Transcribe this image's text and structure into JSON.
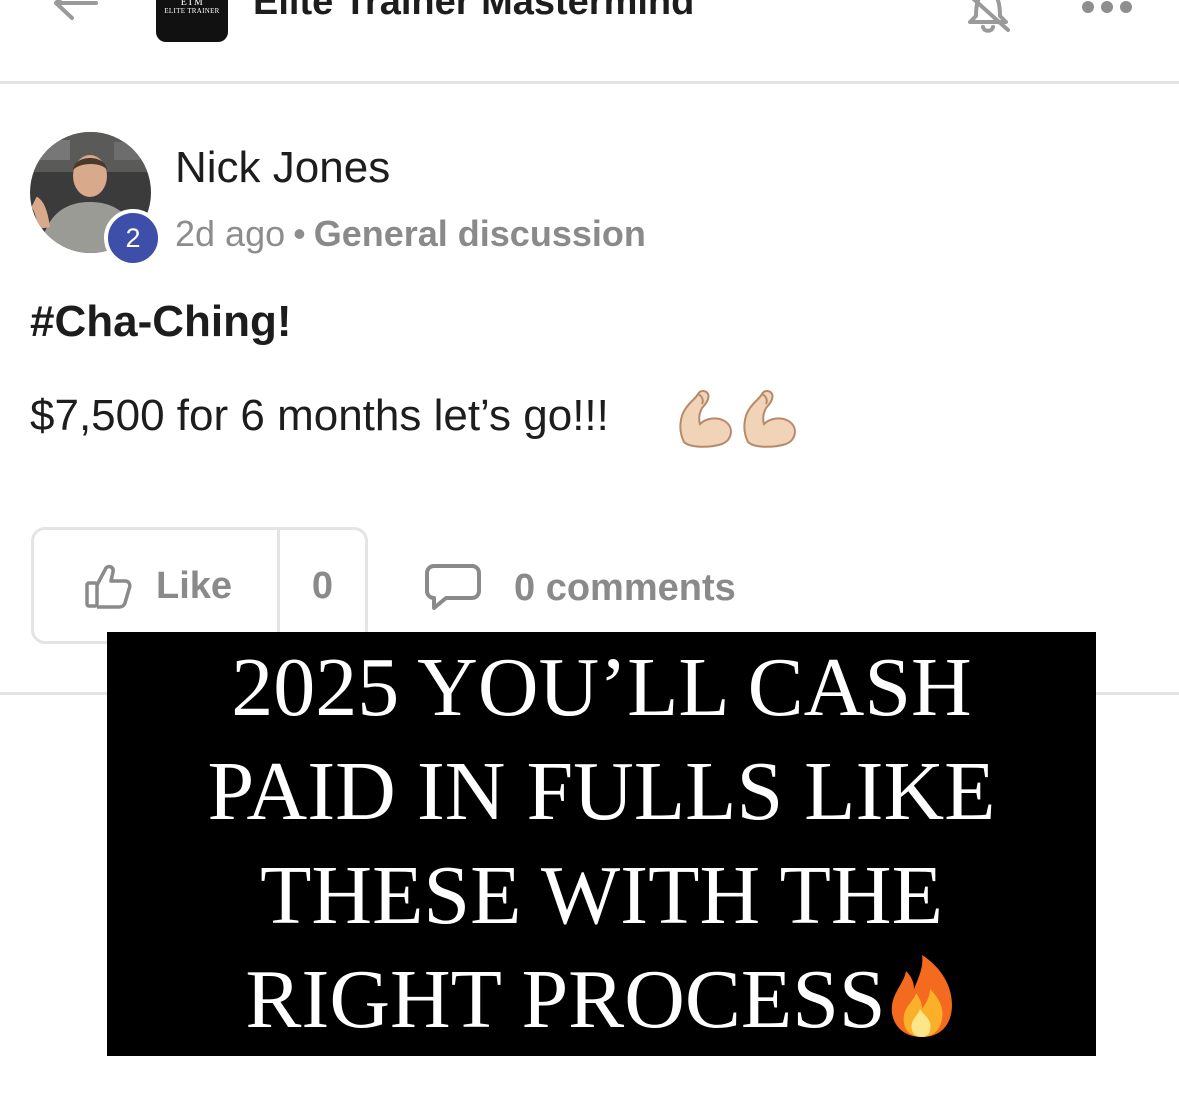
{
  "header": {
    "group_title": "Elite Trainer Mastermind",
    "logo_mark": "ETM",
    "logo_sub": "ELITE TRAINER",
    "back_icon": "arrow-left-icon",
    "bell_icon": "bell-icon",
    "more_icon": "more-horizontal-icon"
  },
  "post": {
    "author": "Nick Jones",
    "level": "2",
    "time_ago": "2d ago",
    "separator": "•",
    "category": "General discussion",
    "title": "#Cha-Ching!",
    "body": "$7,500 for 6 months let’s go!!!",
    "body_emojis": "flexed-biceps-icon x2"
  },
  "actions": {
    "like_label": "Like",
    "like_count": "0",
    "comments_label": "0 comments"
  },
  "banner": {
    "lines": [
      "2025 YOU’LL CASH",
      "PAID IN FULLS LIKE",
      "THESE WITH THE",
      "RIGHT PROCESS"
    ],
    "end_icon": "fire-icon"
  },
  "colors": {
    "badge_blue": "#3d4fa8",
    "muted_text": "#8a8a8a",
    "border": "#e4e4e4",
    "banner_bg": "#000000"
  }
}
